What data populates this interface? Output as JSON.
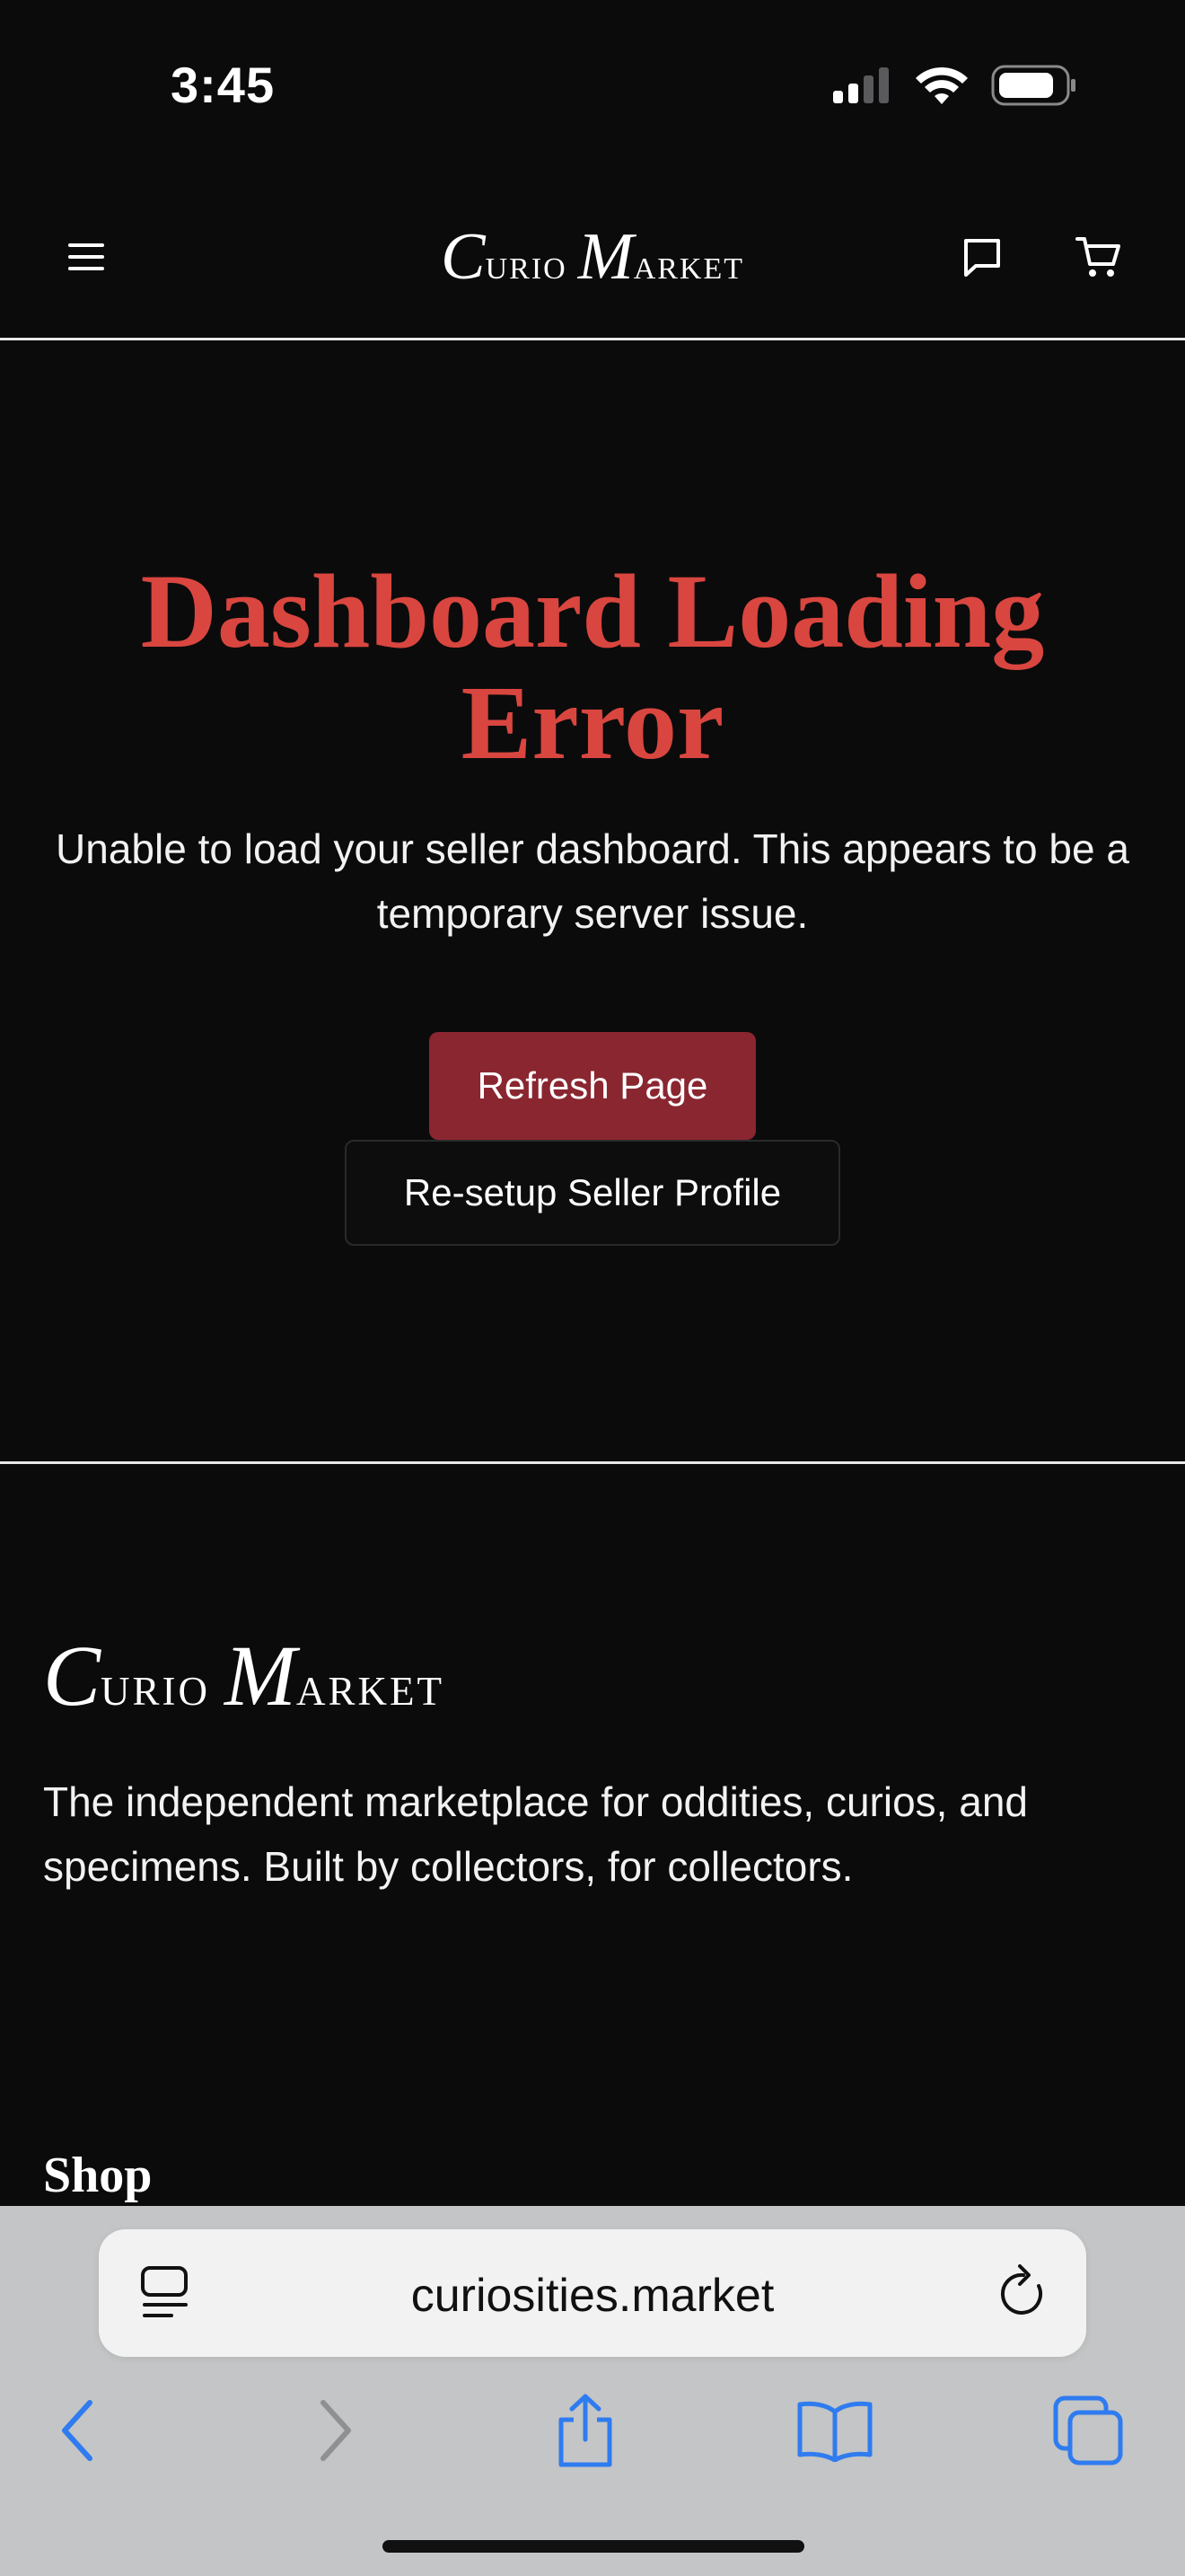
{
  "status_bar": {
    "time": "3:45"
  },
  "header": {
    "logo": {
      "part1_initial": "C",
      "part1_rest": "urio",
      "part2_initial": "M",
      "part2_rest": "arket"
    }
  },
  "error": {
    "title": "Dashboard Loading Error",
    "message": "Unable to load your seller dashboard. This appears to be a temporary server issue.",
    "refresh_label": "Refresh Page",
    "resetup_label": "Re-setup Seller Profile"
  },
  "footer": {
    "logo": {
      "part1_initial": "C",
      "part1_rest": "urio",
      "part2_initial": "M",
      "part2_rest": "arket"
    },
    "tagline": "The independent marketplace for oddities, curios, and specimens. Built by collectors, for collectors.",
    "shop_heading": "Shop"
  },
  "browser": {
    "url": "curiosities.market"
  },
  "colors": {
    "accent_red": "#d9463f",
    "button_red": "#8a2630",
    "background": "#0b0b0c"
  },
  "icons": [
    "menu-icon",
    "chat-icon",
    "cart-icon",
    "reader-icon",
    "reload-icon",
    "back-icon",
    "forward-icon",
    "share-icon",
    "bookmarks-icon",
    "tabs-icon"
  ]
}
